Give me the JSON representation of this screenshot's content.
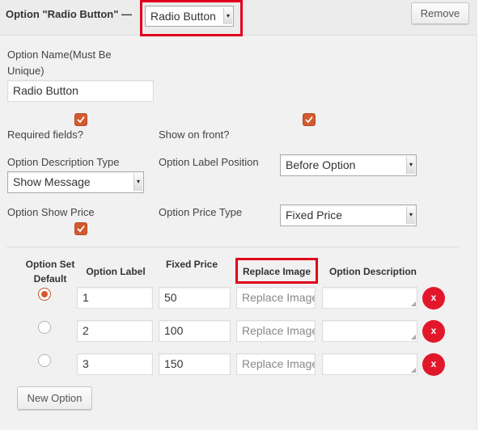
{
  "header": {
    "title": "Option \"Radio Button\" —",
    "type_select_value": "Radio Button",
    "remove_label": "Remove"
  },
  "form": {
    "option_name_label": "Option Name(Must Be Unique)",
    "option_name_value": "Radio Button",
    "required_label": "Required fields?",
    "required_checked": true,
    "show_on_front_label": "Show on front?",
    "show_on_front_checked": true,
    "description_type_label": "Option Description Type",
    "description_type_value": "Show Message",
    "label_position_label": "Option Label Position",
    "label_position_value": "Before Option",
    "show_price_label": "Option Show Price",
    "show_price_checked": true,
    "price_type_label": "Option Price Type",
    "price_type_value": "Fixed Price"
  },
  "table": {
    "headers": {
      "default": "Option Set Default",
      "label": "Option Label",
      "price": "Fixed Price",
      "image": "Replace Image",
      "description": "Option Description"
    },
    "image_placeholder": "Replace Image",
    "rows": [
      {
        "default": true,
        "label": "1",
        "price": "50",
        "description": ""
      },
      {
        "default": false,
        "label": "2",
        "price": "100",
        "description": ""
      },
      {
        "default": false,
        "label": "3",
        "price": "150",
        "description": ""
      }
    ],
    "delete_glyph": "x",
    "new_option_label": "New Option"
  },
  "colors": {
    "accent": "#d35a30",
    "delete": "#e3172a",
    "highlight": "#e0001b"
  }
}
